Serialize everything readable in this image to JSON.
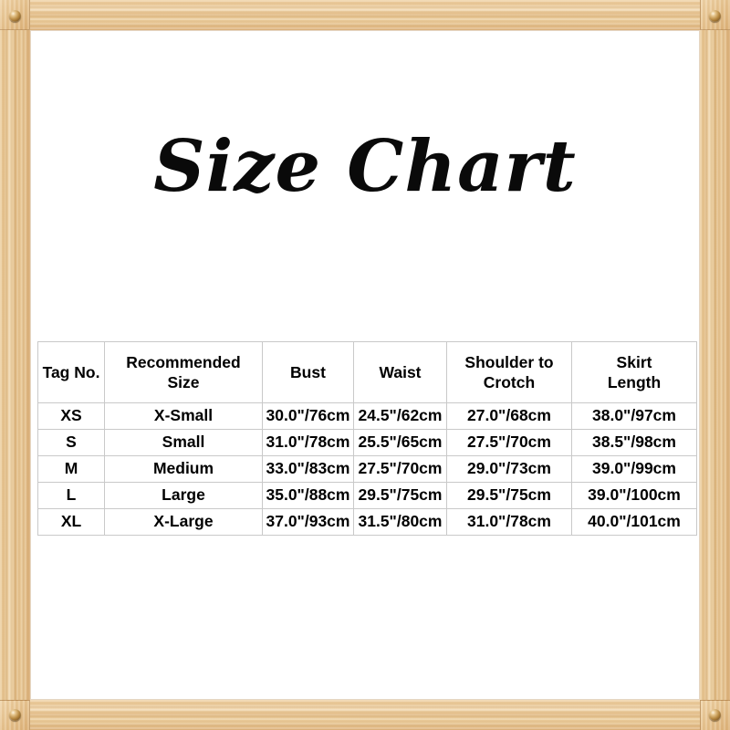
{
  "document": {
    "title": "Size Chart",
    "frame": {
      "material": "wood",
      "wood_color": "#e8c796",
      "screw_color": "#b98b43",
      "screws": [
        "screw-top-left",
        "screw-top-right",
        "screw-bottom-left",
        "screw-bottom-right"
      ]
    },
    "background_color": "#ffffff",
    "text_color": "#000000",
    "grid_color": "#c9c9c9"
  },
  "table": {
    "headers": [
      {
        "lines": [
          "Tag No."
        ]
      },
      {
        "lines": [
          "Recommended",
          "Size"
        ]
      },
      {
        "lines": [
          "Bust"
        ]
      },
      {
        "lines": [
          "Waist"
        ]
      },
      {
        "lines": [
          "Shoulder to",
          "Crotch"
        ]
      },
      {
        "lines": [
          "Skirt",
          "Length"
        ]
      }
    ],
    "rows": [
      {
        "tag": "XS",
        "recommended_size": "X-Small",
        "bust": "30.0\"/76cm",
        "waist": "24.5\"/62cm",
        "shoulder_to_crotch": "27.0\"/68cm",
        "skirt_length": "38.0\"/97cm"
      },
      {
        "tag": "S",
        "recommended_size": "Small",
        "bust": "31.0\"/78cm",
        "waist": "25.5\"/65cm",
        "shoulder_to_crotch": "27.5\"/70cm",
        "skirt_length": "38.5\"/98cm"
      },
      {
        "tag": "M",
        "recommended_size": "Medium",
        "bust": "33.0\"/83cm",
        "waist": "27.5\"/70cm",
        "shoulder_to_crotch": "29.0\"/73cm",
        "skirt_length": "39.0\"/99cm"
      },
      {
        "tag": "L",
        "recommended_size": "Large",
        "bust": "35.0\"/88cm",
        "waist": "29.5\"/75cm",
        "shoulder_to_crotch": "29.5\"/75cm",
        "skirt_length": "39.0\"/100cm"
      },
      {
        "tag": "XL",
        "recommended_size": "X-Large",
        "bust": "37.0\"/93cm",
        "waist": "31.5\"/80cm",
        "shoulder_to_crotch": "31.0\"/78cm",
        "skirt_length": "40.0\"/101cm"
      }
    ]
  }
}
